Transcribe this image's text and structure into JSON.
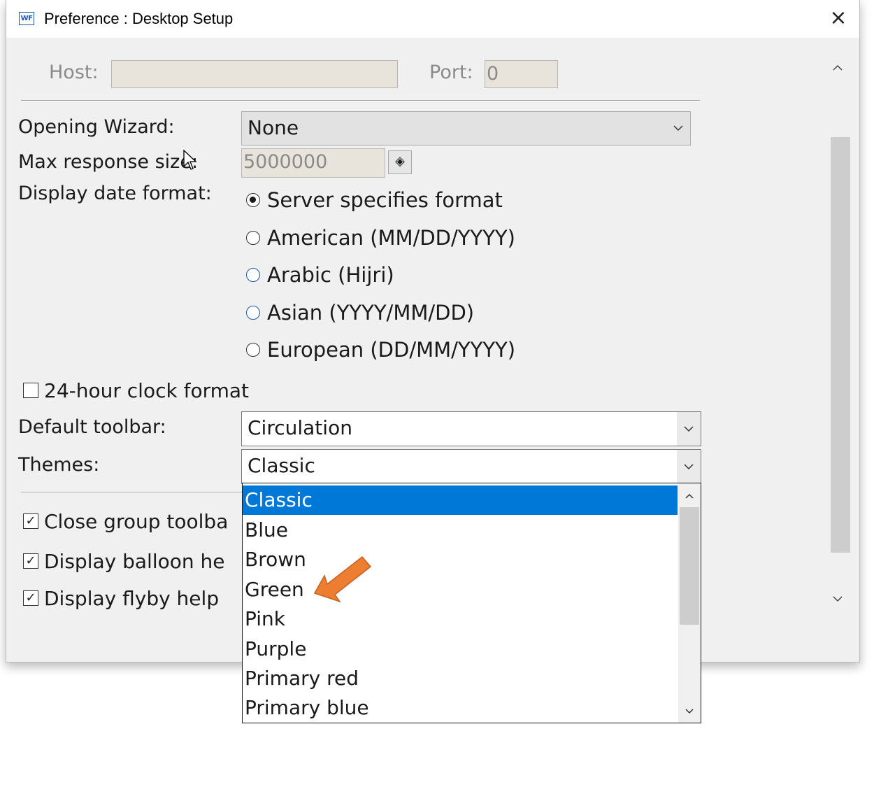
{
  "window": {
    "title": "Preference : Desktop Setup",
    "app_icon_text": "WF",
    "close_icon": "×"
  },
  "connection": {
    "host_label": "Host:",
    "host_value": "",
    "port_label": "Port:",
    "port_value": "0"
  },
  "opening_wizard": {
    "label": "Opening Wizard:",
    "value": "None"
  },
  "max_response": {
    "label": "Max response size:",
    "value": "5000000",
    "spin_icon": "◈"
  },
  "date_format": {
    "label": "Display date format:",
    "options": [
      {
        "label": "Server specifies format",
        "selected": true
      },
      {
        "label": "American (MM/DD/YYYY)",
        "selected": false
      },
      {
        "label": "Arabic (Hijri)",
        "selected": false
      },
      {
        "label": "Asian (YYYY/MM/DD)",
        "selected": false
      },
      {
        "label": "European (DD/MM/YYYY)",
        "selected": false
      }
    ]
  },
  "clock": {
    "label": "24-hour clock format",
    "checked": false
  },
  "default_toolbar": {
    "label": "Default toolbar:",
    "value": "Circulation"
  },
  "themes": {
    "label": "Themes:",
    "value": "Classic",
    "options": [
      "Classic",
      "Blue",
      "Brown",
      "Green",
      "Pink",
      "Purple",
      "Primary red",
      "Primary blue"
    ],
    "selected_index": 0,
    "highlight_color": "#0078d7"
  },
  "checkboxes": [
    {
      "label": "Close group toolba",
      "checked": true
    },
    {
      "label": "Display balloon he",
      "checked": true
    },
    {
      "label": "Display flyby help",
      "checked": true
    }
  ],
  "annotation": {
    "arrow_color": "#ed7d31",
    "points_to": "Green"
  },
  "icons": {
    "chevron_down": "⌄",
    "scroll_up": "^",
    "scroll_down": "⌄",
    "check": "✓"
  }
}
